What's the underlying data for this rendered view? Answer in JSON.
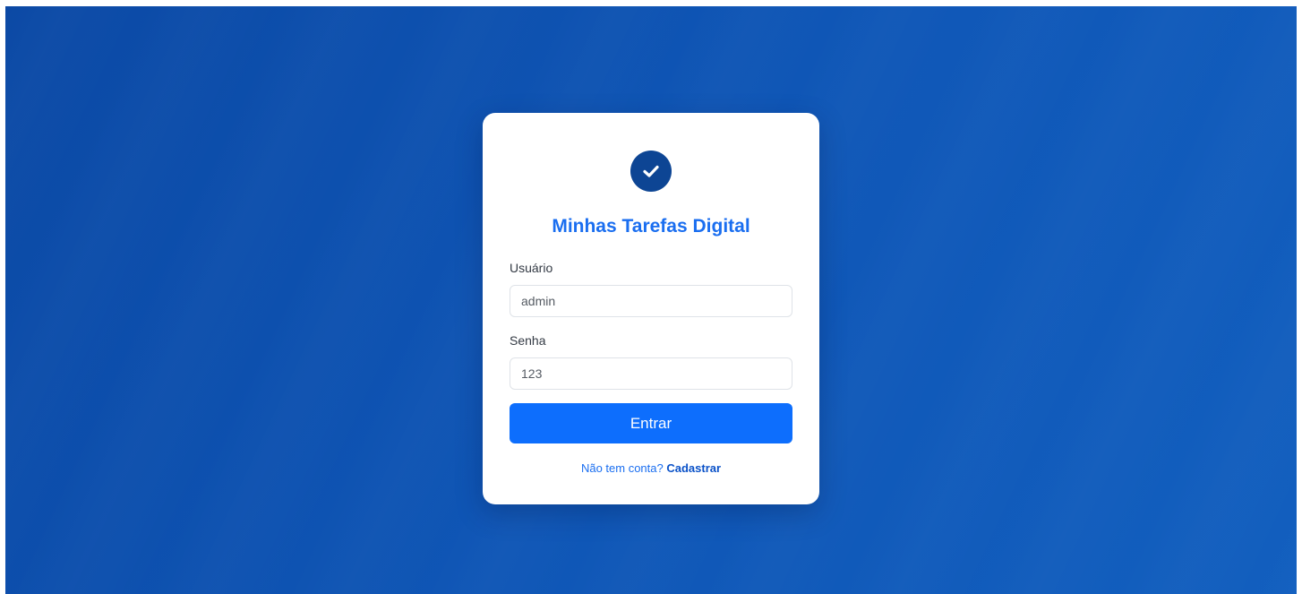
{
  "login": {
    "logo_icon": "check-circle-icon",
    "title": "Minhas Tarefas Digital",
    "username_label": "Usuário",
    "username_value": "admin",
    "password_label": "Senha",
    "password_value": "123",
    "submit_label": "Entrar",
    "signup_prompt": "Não tem conta?",
    "signup_link": "Cadastrar"
  },
  "colors": {
    "background": "#0f56b6",
    "logo_circle": "#0d4594",
    "title": "#1a6ef0",
    "button": "#0d6efd"
  }
}
